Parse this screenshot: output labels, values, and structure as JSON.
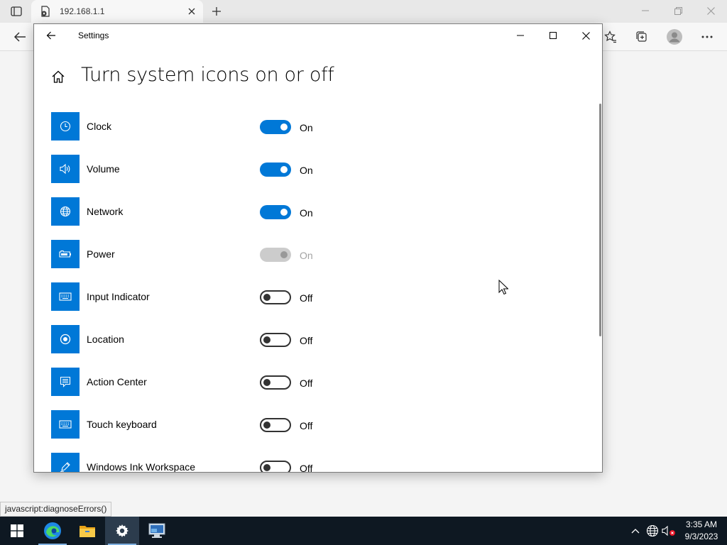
{
  "browser": {
    "tab_title": "192.168.1.1",
    "status_url": "javascript:diagnoseErrors()"
  },
  "settings": {
    "app_title": "Settings",
    "page_heading": "Turn system icons on or off",
    "items": [
      {
        "label": "Clock",
        "state": "On",
        "toggle": "on",
        "icon": "clock-icon"
      },
      {
        "label": "Volume",
        "state": "On",
        "toggle": "on",
        "icon": "volume-icon"
      },
      {
        "label": "Network",
        "state": "On",
        "toggle": "on",
        "icon": "network-globe-icon"
      },
      {
        "label": "Power",
        "state": "On",
        "toggle": "disabled",
        "icon": "battery-icon"
      },
      {
        "label": "Input Indicator",
        "state": "Off",
        "toggle": "off",
        "icon": "keyboard-icon"
      },
      {
        "label": "Location",
        "state": "Off",
        "toggle": "off",
        "icon": "location-icon"
      },
      {
        "label": "Action Center",
        "state": "Off",
        "toggle": "off",
        "icon": "action-center-icon"
      },
      {
        "label": "Touch keyboard",
        "state": "Off",
        "toggle": "off",
        "icon": "touch-keyboard-icon"
      },
      {
        "label": "Windows Ink Workspace",
        "state": "Off",
        "toggle": "off",
        "icon": "pen-icon"
      }
    ]
  },
  "taskbar": {
    "time": "3:35 AM",
    "date": "9/3/2023",
    "apps": [
      "start-button",
      "edge-icon",
      "file-explorer-icon",
      "settings-gear-icon",
      "remote-desktop-icon"
    ]
  },
  "colors": {
    "accent": "#0078d7",
    "taskbar": "#0e1822"
  }
}
